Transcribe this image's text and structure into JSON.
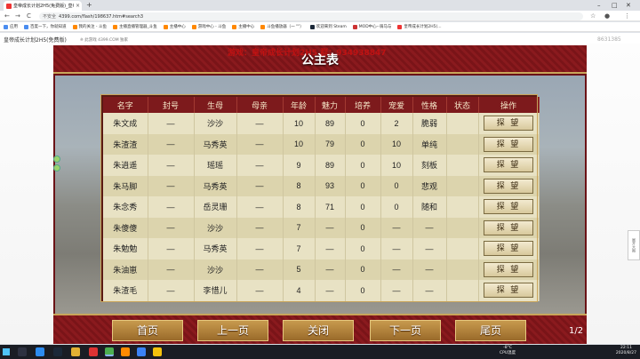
{
  "browser": {
    "tab_title": "皇帝成长计划2H5(免费版)_皇帝...",
    "tab_close": "×",
    "new_tab": "+",
    "window_controls": [
      "–",
      "□",
      "✕"
    ],
    "nav": {
      "back": "←",
      "forward": "→",
      "reload": "C"
    },
    "address_security": "不安全",
    "address_url": "4399.com/flash/198637.htm#search3",
    "bookmarks": [
      "应用",
      "百度一下，你就知道",
      "我的关注 - 斗鱼",
      "主播直播管理器_斗鱼",
      "主播中心",
      "游戏中心 - 斗鱼",
      "主播中心",
      "斗鱼播放器（一 \"\"）",
      "欢迎来到 Steam",
      "MOD中心--骑马与",
      "皇帝成长计划2H5(..."
    ],
    "side_panel_label": "展开大图"
  },
  "game_page": {
    "title": "皇帝成长计划2H5(免费版)",
    "notice": "※ 此游戏 4399.COM 独家",
    "watermark": "游戏：皇帝成长计划2H5   群：934938847",
    "corner_id": "8631385"
  },
  "game": {
    "panel_title": "公主表",
    "table": {
      "headers": [
        "名字",
        "封号",
        "生母",
        "母亲",
        "年龄",
        "魅力",
        "培养",
        "宠爱",
        "性格",
        "状态",
        "操作"
      ],
      "rows": [
        [
          "朱文成",
          "—",
          "沙沙",
          "—",
          "10",
          "89",
          "0",
          "2",
          "脆弱",
          "",
          "探 望"
        ],
        [
          "朱渣渣",
          "—",
          "马秀英",
          "—",
          "10",
          "79",
          "0",
          "10",
          "单纯",
          "",
          "探 望"
        ],
        [
          "朱逍遥",
          "—",
          "瑶瑶",
          "—",
          "9",
          "89",
          "0",
          "10",
          "刻板",
          "",
          "探 望"
        ],
        [
          "朱马脚",
          "—",
          "马秀英",
          "—",
          "8",
          "93",
          "0",
          "0",
          "悲观",
          "",
          "探 望"
        ],
        [
          "朱念秀",
          "—",
          "岳灵珊",
          "—",
          "8",
          "71",
          "0",
          "0",
          "随和",
          "",
          "探 望"
        ],
        [
          "朱傻傻",
          "—",
          "沙沙",
          "—",
          "7",
          "—",
          "0",
          "—",
          "—",
          "",
          "探 望"
        ],
        [
          "朱勉勉",
          "—",
          "马秀英",
          "—",
          "7",
          "—",
          "0",
          "—",
          "—",
          "",
          "探 望"
        ],
        [
          "朱油崽",
          "—",
          "沙沙",
          "—",
          "5",
          "—",
          "0",
          "—",
          "—",
          "",
          "探 望"
        ],
        [
          "朱渣毛",
          "—",
          "李惜儿",
          "—",
          "4",
          "—",
          "0",
          "—",
          "—",
          "",
          "探 望"
        ]
      ]
    },
    "buttons": {
      "first": "首页",
      "prev": "上一页",
      "close": "关闭",
      "next": "下一页",
      "last": "尾页"
    },
    "page_indicator": "1/2"
  },
  "taskbar": {
    "weather": [
      "-8°C",
      "CPU温度"
    ],
    "time": "22:11",
    "date": "2020/8/27"
  }
}
